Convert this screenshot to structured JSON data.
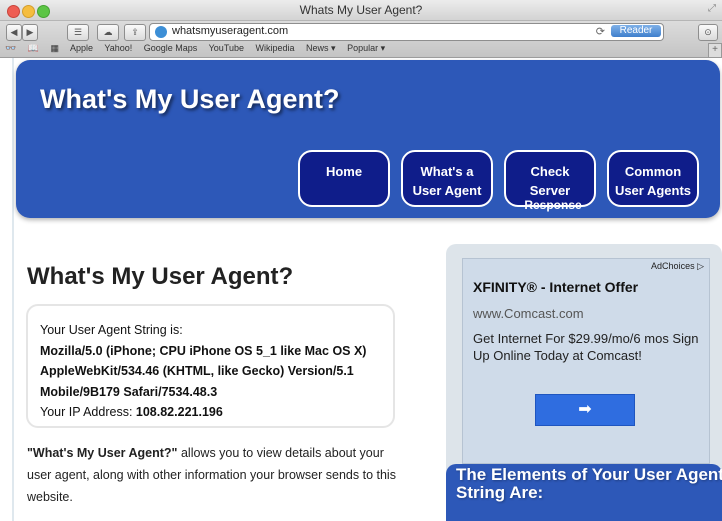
{
  "window": {
    "title": "Whats My User Agent?"
  },
  "toolbar": {
    "url": "whatsmyuseragent.com",
    "reader_label": "Reader",
    "bookmarks": [
      "Apple",
      "Yahoo!",
      "Google Maps",
      "YouTube",
      "Wikipedia",
      "News ▾",
      "Popular ▾"
    ]
  },
  "site": {
    "title": "What's My User Agent?",
    "nav": [
      {
        "line1": "Home",
        "line2": ""
      },
      {
        "line1": "What's a",
        "line2": "User Agent"
      },
      {
        "line1": "Check",
        "line2": "Server"
      },
      {
        "line1": "Common",
        "line2": "User Agents"
      }
    ],
    "nav_overflow": "Response"
  },
  "main": {
    "heading": "What's My User Agent?",
    "ua_label": "Your User Agent String is:",
    "ua_line1": "Mozilla/5.0 (iPhone; CPU iPhone OS 5_1 like Mac OS X)",
    "ua_line2": "AppleWebKit/534.46 (KHTML, like Gecko) Version/5.1",
    "ua_line3": "Mobile/9B179 Safari/7534.48.3",
    "ip_label": "Your IP Address: ",
    "ip_value": "108.82.221.196",
    "desc_bold": "\"What's My User Agent?\"",
    "desc_rest": " allows you to view details about your user agent, along with other information your browser sends to this website."
  },
  "ad": {
    "adchoices": "AdChoices ▷",
    "title": "XFINITY® - Internet Offer",
    "url": "www.Comcast.com",
    "text": "Get Internet For $29.99/mo/6 mos Sign Up Online Today at Comcast!",
    "button": "➡"
  },
  "sidebar": {
    "elements_title": "The Elements of Your User Agent String Are:"
  },
  "colors": {
    "header_blue": "#2d58b8",
    "nav_navy": "#0f1d8a",
    "ad_button": "#2f6de0"
  }
}
